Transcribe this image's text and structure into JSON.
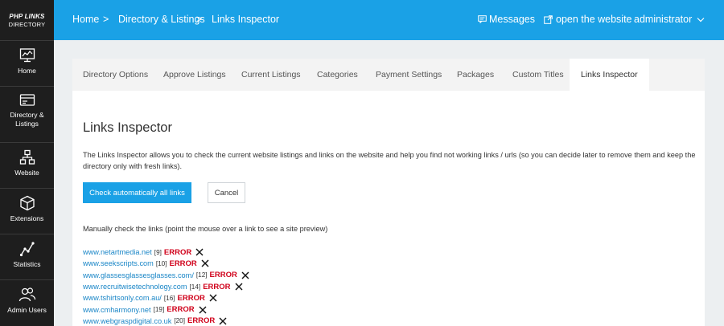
{
  "app": {
    "brand_line1": "PHP LINKS",
    "brand_line2": "DIRECTORY",
    "accent": "#1aa1e6",
    "error_color": "#d0021b"
  },
  "sidebar": {
    "items": [
      {
        "label": "Home",
        "icon": "monitor-chart-icon"
      },
      {
        "label": "Directory & Listings",
        "icon": "card-icon"
      },
      {
        "label": "Website",
        "icon": "sitemap-icon"
      },
      {
        "label": "Extensions",
        "icon": "cube-icon"
      },
      {
        "label": "Statistics",
        "icon": "line-chart-icon"
      },
      {
        "label": "Admin Users",
        "icon": "users-icon"
      }
    ]
  },
  "topbar": {
    "breadcrumb": [
      "Home",
      "Directory & Listings",
      "Links Inspector"
    ],
    "separator": ">",
    "messages": "Messages",
    "open_website": "open the website",
    "user": "administrator"
  },
  "tabs": [
    {
      "label": "Directory Options",
      "active": false
    },
    {
      "label": "Approve Listings",
      "active": false
    },
    {
      "label": "Current Listings",
      "active": false
    },
    {
      "label": "Categories",
      "active": false
    },
    {
      "label": "Payment Settings",
      "active": false
    },
    {
      "label": "Packages",
      "active": false
    },
    {
      "label": "Custom Titles",
      "active": false
    },
    {
      "label": "Links Inspector",
      "active": true
    }
  ],
  "main": {
    "title": "Links Inspector",
    "description": "The Links Inspector allows you to check the current website listings and links on the website and help you find not working links / urls (so you can decide later to remove them and keep the directory only with fresh links).",
    "check_button": "Check automatically all links",
    "cancel_button": "Cancel",
    "manual_text": "Manually check the links (point the mouse over a link to see a site preview)",
    "links": [
      {
        "url": "www.netartmedia.net",
        "id": "[9]",
        "status": "ERROR"
      },
      {
        "url": "www.seekscripts.com",
        "id": "[10]",
        "status": "ERROR"
      },
      {
        "url": "www.glassesglassesglasses.com/",
        "id": "[12]",
        "status": "ERROR"
      },
      {
        "url": "www.recruitwisetechnology.com",
        "id": "[14]",
        "status": "ERROR"
      },
      {
        "url": "www.tshirtsonly.com.au/",
        "id": "[16]",
        "status": "ERROR"
      },
      {
        "url": "www.cmharmony.net",
        "id": "[19]",
        "status": "ERROR"
      },
      {
        "url": "www.webgraspdigital.co.uk",
        "id": "[20]",
        "status": "ERROR"
      }
    ]
  }
}
